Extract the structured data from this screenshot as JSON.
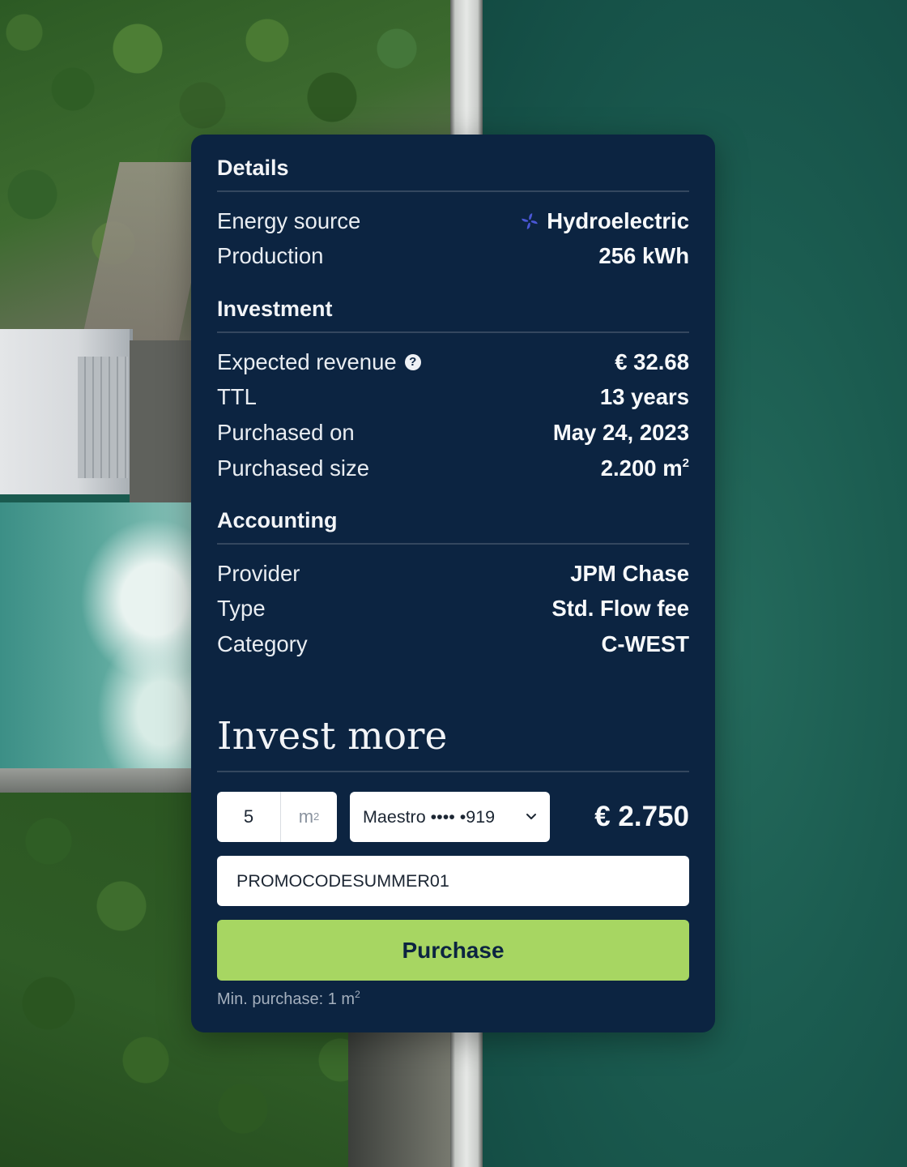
{
  "details": {
    "title": "Details",
    "rows": [
      {
        "label": "Energy source",
        "value": "Hydroelectric",
        "icon": "hydro-turbine-icon"
      },
      {
        "label": "Production",
        "value": "256 kWh"
      }
    ]
  },
  "investment": {
    "title": "Investment",
    "rows": [
      {
        "label": "Expected revenue",
        "value": "€ 32.68",
        "icon": "help-icon"
      },
      {
        "label": "TTL",
        "value": "13 years"
      },
      {
        "label": "Purchased on",
        "value": "May 24, 2023"
      },
      {
        "label": "Purchased size",
        "value": "2.200 m",
        "unit_sup": "2"
      }
    ]
  },
  "accounting": {
    "title": "Accounting",
    "rows": [
      {
        "label": "Provider",
        "value": "JPM Chase"
      },
      {
        "label": "Type",
        "value": "Std. Flow fee"
      },
      {
        "label": "Category",
        "value": "C-WEST"
      }
    ]
  },
  "invest_more": {
    "title": "Invest more",
    "quantity": "5",
    "quantity_unit": "m",
    "quantity_unit_sup": "2",
    "payment_method": "Maestro •••• •919",
    "total": "€ 2.750",
    "promo_code": "PROMOCODESUMMER01",
    "purchase_label": "Purchase",
    "min_note": "Min. purchase: 1 m",
    "min_note_sup": "2"
  },
  "colors": {
    "card_bg": "#0c2441",
    "accent_green": "#a7d662",
    "icon_blue": "#4a57d6"
  }
}
